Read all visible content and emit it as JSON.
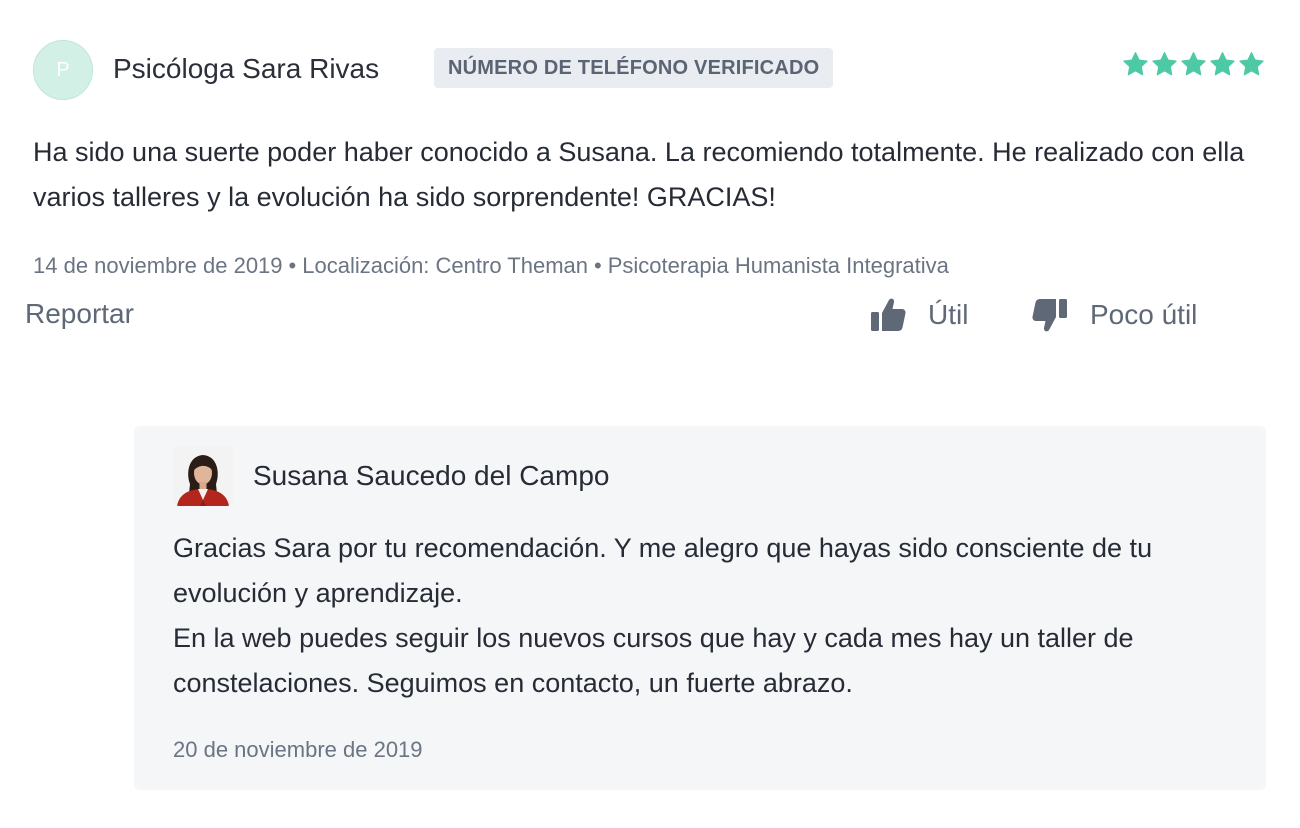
{
  "review": {
    "avatar_initial": "P",
    "reviewer_name": "Psicóloga Sara Rivas",
    "verified_badge": "NÚMERO DE TELÉFONO VERIFICADO",
    "rating": 5,
    "rating_max": 5,
    "star_color": "#4ec9a5",
    "text": "Ha sido una suerte poder haber conocido a Susana. La recomiendo totalmente. He realizado con ella varios talleres y la evolución ha sido sorprendente! GRACIAS!",
    "meta": {
      "date": "14 de noviembre de 2019",
      "separator": "•",
      "location": "Localización: Centro Theman",
      "service": "Psicoterapia Humanista Integrativa"
    },
    "actions": {
      "report_label": "Reportar",
      "useful_label": "Útil",
      "not_useful_label": "Poco útil",
      "useful_icon": "thumbs-up-icon",
      "not_useful_icon": "thumbs-down-icon"
    }
  },
  "reply": {
    "author_name": "Susana Saucedo del Campo",
    "paragraphs": [
      "Gracias Sara por tu recomendación. Y me alegro que hayas sido consciente de tu evolución y aprendizaje.",
      "En la web puedes seguir los nuevos cursos que hay y cada mes hay un taller de constelaciones. Seguimos en contacto, un fuerte abrazo."
    ],
    "date": "20 de noviembre de 2019"
  }
}
